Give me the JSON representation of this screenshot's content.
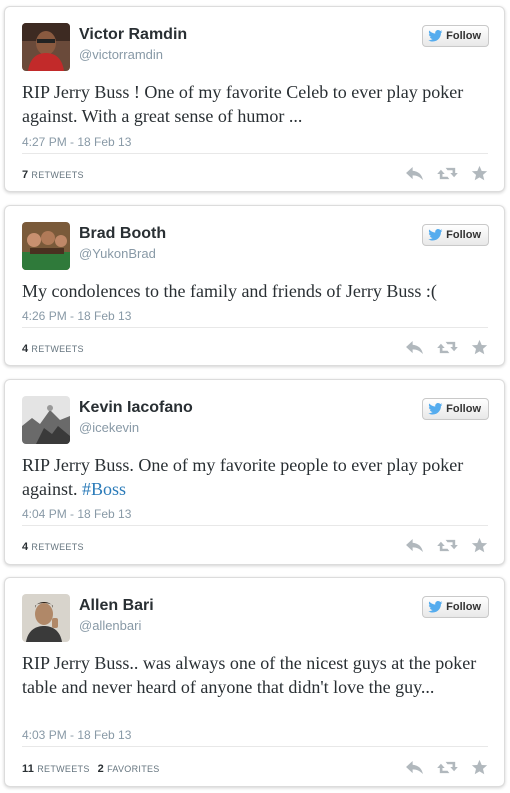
{
  "tweets": [
    {
      "name": "Victor Ramdin",
      "handle": "@victorramdin",
      "follow_label": "Follow",
      "text": "RIP Jerry Buss ! One of my favorite Celeb to ever play poker against. With a great sense of humor ...",
      "timestamp": "4:27 PM - 18 Feb 13",
      "retweets_count": "7",
      "retweets_label": "RETWEETS"
    },
    {
      "name": "Brad Booth",
      "handle": "@YukonBrad",
      "follow_label": "Follow",
      "text": "My condolences to the family and friends of Jerry Buss :(",
      "timestamp": "4:26 PM - 18 Feb 13",
      "retweets_count": "4",
      "retweets_label": "RETWEETS"
    },
    {
      "name": "Kevin Iacofano",
      "handle": "@icekevin",
      "follow_label": "Follow",
      "text": "RIP Jerry Buss. One of my favorite people to ever play poker against. ",
      "hashtag": "#Boss",
      "timestamp": "4:04 PM - 18 Feb 13",
      "retweets_count": "4",
      "retweets_label": "RETWEETS"
    },
    {
      "name": "Allen Bari",
      "handle": "@allenbari",
      "follow_label": "Follow",
      "text": "RIP Jerry Buss.. was always one of the nicest guys at the poker table and never heard of anyone that didn't love the guy...",
      "timestamp": "4:03 PM - 18 Feb 13",
      "retweets_count": "11",
      "retweets_label": "RETWEETS",
      "favorites_count": "2",
      "favorites_label": "FAVORITES"
    }
  ],
  "icons": {
    "bird": "twitter-bird-icon",
    "reply": "reply-icon",
    "retweet": "retweet-icon",
    "favorite": "star-icon"
  },
  "colors": {
    "bird_blue": "#55acee",
    "hashtag": "#2b7bb9",
    "action_gray": "#b1b8bd"
  }
}
